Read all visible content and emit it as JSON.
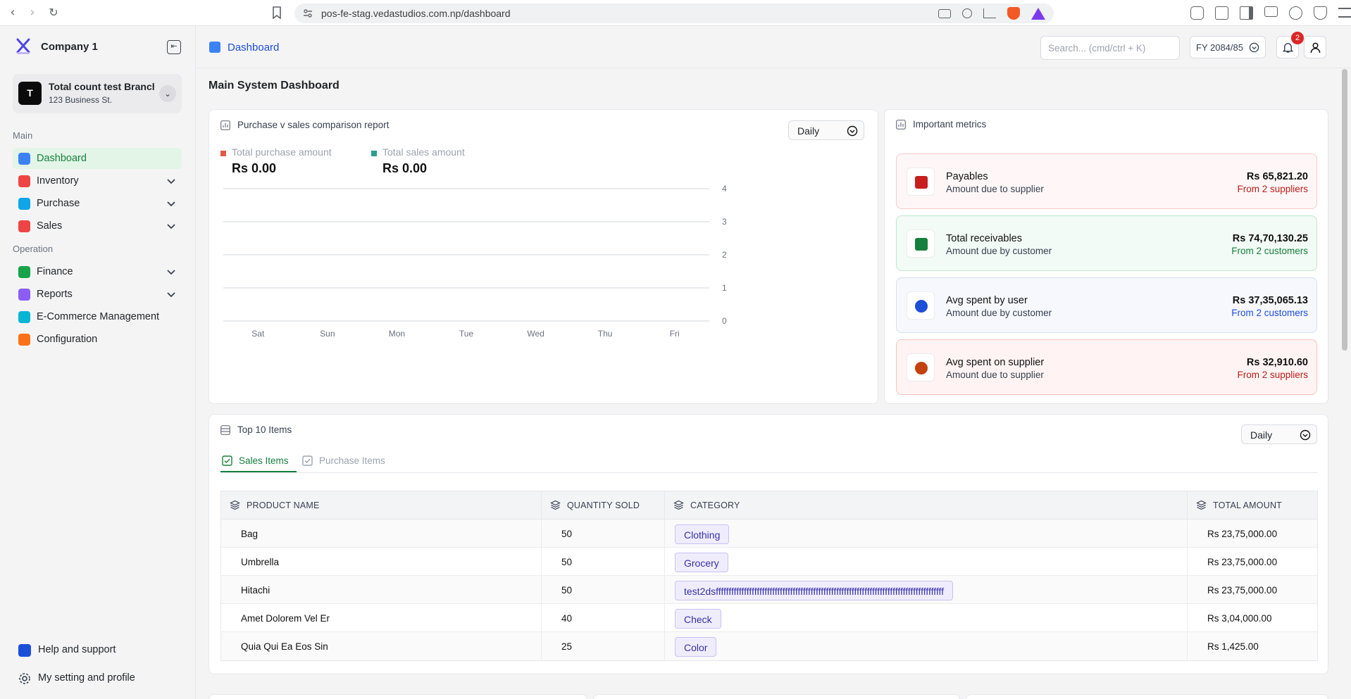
{
  "browser": {
    "url": "pos-fe-stag.vedastudios.com.np/dashboard"
  },
  "sidebar": {
    "company_name": "Company 1",
    "branch": {
      "avatar_letter": "T",
      "name": "Total count test Branch",
      "address": "123 Business St."
    },
    "section_main": "Main",
    "section_operation": "Operation",
    "items": [
      {
        "label": "Dashboard",
        "icon": "dashboard-icon",
        "color": "#3b82f6"
      },
      {
        "label": "Inventory",
        "icon": "inventory-icon",
        "color": "#ef4444"
      },
      {
        "label": "Purchase",
        "icon": "cart-icon",
        "color": "#0ea5e9"
      },
      {
        "label": "Sales",
        "icon": "sales-icon",
        "color": "#ef4444"
      },
      {
        "label": "Finance",
        "icon": "finance-icon",
        "color": "#16a34a"
      },
      {
        "label": "Reports",
        "icon": "reports-icon",
        "color": "#8b5cf6"
      },
      {
        "label": "E-Commerce Management",
        "icon": "ecommerce-icon",
        "color": "#06b6d4"
      },
      {
        "label": "Configuration",
        "icon": "configuration-icon",
        "color": "#f97316"
      }
    ],
    "help_label": "Help and support",
    "settings_label": "My setting and profile"
  },
  "header": {
    "breadcrumb": "Dashboard",
    "search_placeholder": "Search... (cmd/ctrl + K)",
    "fy_label": "FY 2084/85",
    "notification_count": "2"
  },
  "main": {
    "title": "Main System Dashboard",
    "comparison": {
      "title": "Purchase v sales comparison report",
      "period": "Daily",
      "legend": [
        {
          "name": "Total purchase amount",
          "value": "Rs 0.00",
          "color": "#e05a47"
        },
        {
          "name": "Total sales amount",
          "value": "Rs 0.00",
          "color": "#2a9d8f"
        }
      ]
    },
    "metrics": {
      "title": "Important metrics",
      "cards": [
        {
          "title": "Payables",
          "sub": "Amount due to supplier",
          "value": "Rs 65,821.20",
          "note": "From 2 suppliers",
          "note_color": "#b91c1c",
          "bg": "#fff7f7",
          "border": "#f8caca",
          "icon_color": "#c81e1e"
        },
        {
          "title": "Total receivables",
          "sub": "Amount due by customer",
          "value": "Rs 74,70,130.25",
          "note": "From 2 customers",
          "note_color": "#15803d",
          "bg": "#f2fbf5",
          "border": "#bfe8cc",
          "icon_color": "#15803d"
        },
        {
          "title": "Avg spent by user",
          "sub": "Amount due by customer",
          "value": "Rs 37,35,065.13",
          "note": "From 2 customers",
          "note_color": "#1d4ed8",
          "bg": "#f6f8fd",
          "border": "#d6def2",
          "icon_color": "#1d4ed8"
        },
        {
          "title": "Avg spent on supplier",
          "sub": "Amount due to supplier",
          "value": "Rs 32,910.60",
          "note": "From 2 suppliers",
          "note_color": "#b91c1c",
          "bg": "#fff4f3",
          "border": "#f6c4bd",
          "icon_color": "#c2410c"
        }
      ]
    },
    "top_items": {
      "title": "Top 10 Items",
      "period": "Daily",
      "tabs": [
        "Sales Items",
        "Purchase Items"
      ],
      "columns": [
        "PRODUCT NAME",
        "QUANTITY SOLD",
        "CATEGORY",
        "TOTAL AMOUNT"
      ],
      "rows": [
        {
          "name": "Bag",
          "qty": "50",
          "category": "Clothing",
          "amount": "Rs 23,75,000.00"
        },
        {
          "name": "Umbrella",
          "qty": "50",
          "category": "Grocery",
          "amount": "Rs 23,75,000.00"
        },
        {
          "name": "Hitachi",
          "qty": "50",
          "category": "test2dsfffffffffffffffffffffffffffffffffffffffffffffffffffffffffffffffffffffffffffffffffffffffff",
          "amount": "Rs 23,75,000.00"
        },
        {
          "name": "Amet Dolorem Vel Er",
          "qty": "40",
          "category": "Check",
          "amount": "Rs 3,04,000.00"
        },
        {
          "name": "Quia Qui Ea Eos Sin",
          "qty": "25",
          "category": "Color",
          "amount": "Rs 1,425.00"
        }
      ]
    }
  },
  "chart_data": {
    "type": "bar",
    "categories": [
      "Sat",
      "Sun",
      "Mon",
      "Tue",
      "Wed",
      "Thu",
      "Fri"
    ],
    "series": [
      {
        "name": "Total purchase amount",
        "values": [
          0,
          0,
          0,
          0,
          0,
          0,
          0
        ]
      },
      {
        "name": "Total sales amount",
        "values": [
          0,
          0,
          0,
          0,
          0,
          0,
          0
        ]
      }
    ],
    "ylim": [
      0,
      4
    ],
    "yticks": [
      0,
      1,
      2,
      3,
      4
    ],
    "grid": true,
    "legend": "top-left"
  }
}
